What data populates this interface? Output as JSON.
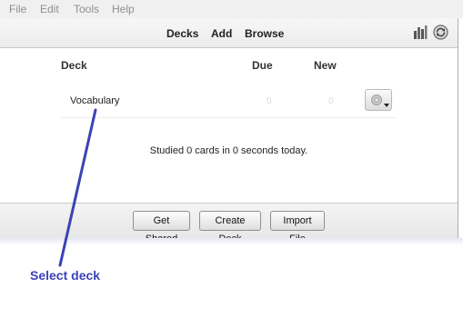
{
  "menu": {
    "file": "File",
    "edit": "Edit",
    "tools": "Tools",
    "help": "Help"
  },
  "toolbar": {
    "decks": "Decks",
    "add": "Add",
    "browse": "Browse",
    "stats_icon": "bar-chart-icon",
    "sync_icon": "sync-icon"
  },
  "deck_list": {
    "headers": {
      "deck": "Deck",
      "due": "Due",
      "new": "New"
    },
    "rows": [
      {
        "name": "Vocabulary",
        "due": "0",
        "new": "0",
        "options_icon": "gear-icon"
      }
    ]
  },
  "studied_text": "Studied 0 cards in 0 seconds today.",
  "bottom_buttons": {
    "get_shared": "Get Shared",
    "create_deck": "Create Deck",
    "import_file": "Import File"
  },
  "annotation": {
    "caption": "Select deck",
    "color": "#3a43b6"
  }
}
